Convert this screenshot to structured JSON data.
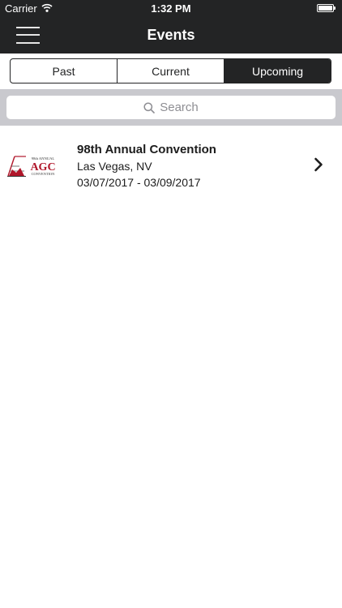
{
  "status_bar": {
    "carrier": "Carrier",
    "time": "1:32 PM"
  },
  "header": {
    "title": "Events"
  },
  "tabs": [
    {
      "label": "Past",
      "active": false
    },
    {
      "label": "Current",
      "active": false
    },
    {
      "label": "Upcoming",
      "active": true
    }
  ],
  "search": {
    "placeholder": "Search"
  },
  "events": [
    {
      "name": "98th Annual Convention",
      "location": "Las Vegas, NV",
      "dates": "03/07/2017 - 03/09/2017",
      "logo": {
        "top_text": "98th ANNUAL",
        "main_text": "AGC",
        "sub_text": "CONVENTION"
      }
    }
  ],
  "colors": {
    "bar": "#232425",
    "search_background": "#c9c9ce",
    "logo_red": "#b0162a"
  },
  "icons": {
    "menu": "hamburger-icon",
    "wifi": "wifi-icon",
    "battery": "battery-icon",
    "search": "search-icon",
    "disclosure": "chevron-right-icon"
  }
}
